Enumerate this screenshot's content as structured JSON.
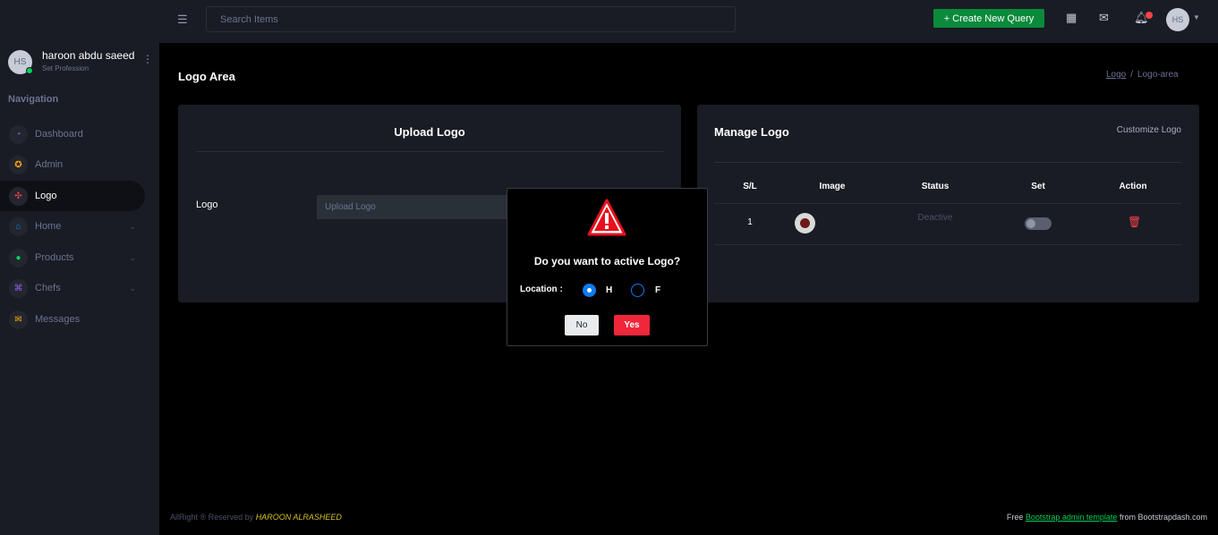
{
  "user": {
    "initials": "HS",
    "name": "haroon abdu saeed",
    "role": "Set Profession"
  },
  "navigation": {
    "title": "Navigation",
    "items": [
      {
        "label": "Dashboard",
        "icon": "speedometer-icon",
        "color": "#8f5fe8"
      },
      {
        "label": "Admin",
        "icon": "admin-icon",
        "color": "#ffab00"
      },
      {
        "label": "Logo",
        "icon": "logo-icon",
        "color": "#fc424a",
        "active": true
      },
      {
        "label": "Home",
        "icon": "home-icon",
        "color": "#0090e7"
      },
      {
        "label": "Products",
        "icon": "products-icon",
        "color": "#00d25b"
      },
      {
        "label": "Chefs",
        "icon": "chefs-icon",
        "color": "#8f5fe8"
      },
      {
        "label": "Messages",
        "icon": "messages-icon",
        "color": "#ffab00"
      }
    ]
  },
  "topbar": {
    "search_placeholder": "Search Items",
    "create_label": "+ Create New Query",
    "avatar_initials": "HS"
  },
  "page": {
    "title": "Logo Area",
    "breadcrumb": [
      "Logo",
      "Logo-area"
    ]
  },
  "upload_card": {
    "title": "Upload Logo",
    "field_label": "Logo",
    "field_placeholder": "Upload Logo"
  },
  "manage_card": {
    "title": "Manage Logo",
    "customize_label": "Customize Logo",
    "columns": [
      "S/L",
      "Image",
      "Status",
      "Set",
      "Action"
    ],
    "rows": [
      {
        "sl": "1",
        "status": "Deactive",
        "set": false
      }
    ]
  },
  "modal": {
    "question": "Do you want to active Logo?",
    "location_label": "Location :",
    "options": [
      "H",
      "F"
    ],
    "selected": "H",
    "no_label": "No",
    "yes_label": "Yes"
  },
  "footer": {
    "left_prefix": "AllRight ® Reserved by",
    "left_author": "HAROON ALRASHEED",
    "right_prefix": "Free",
    "right_link": "Bootstrap admin template",
    "right_suffix": "from Bootstrapdash.com"
  },
  "colors": {
    "accent_green": "#00d25b",
    "danger": "#fc424a",
    "primary": "#0d7bf1"
  }
}
